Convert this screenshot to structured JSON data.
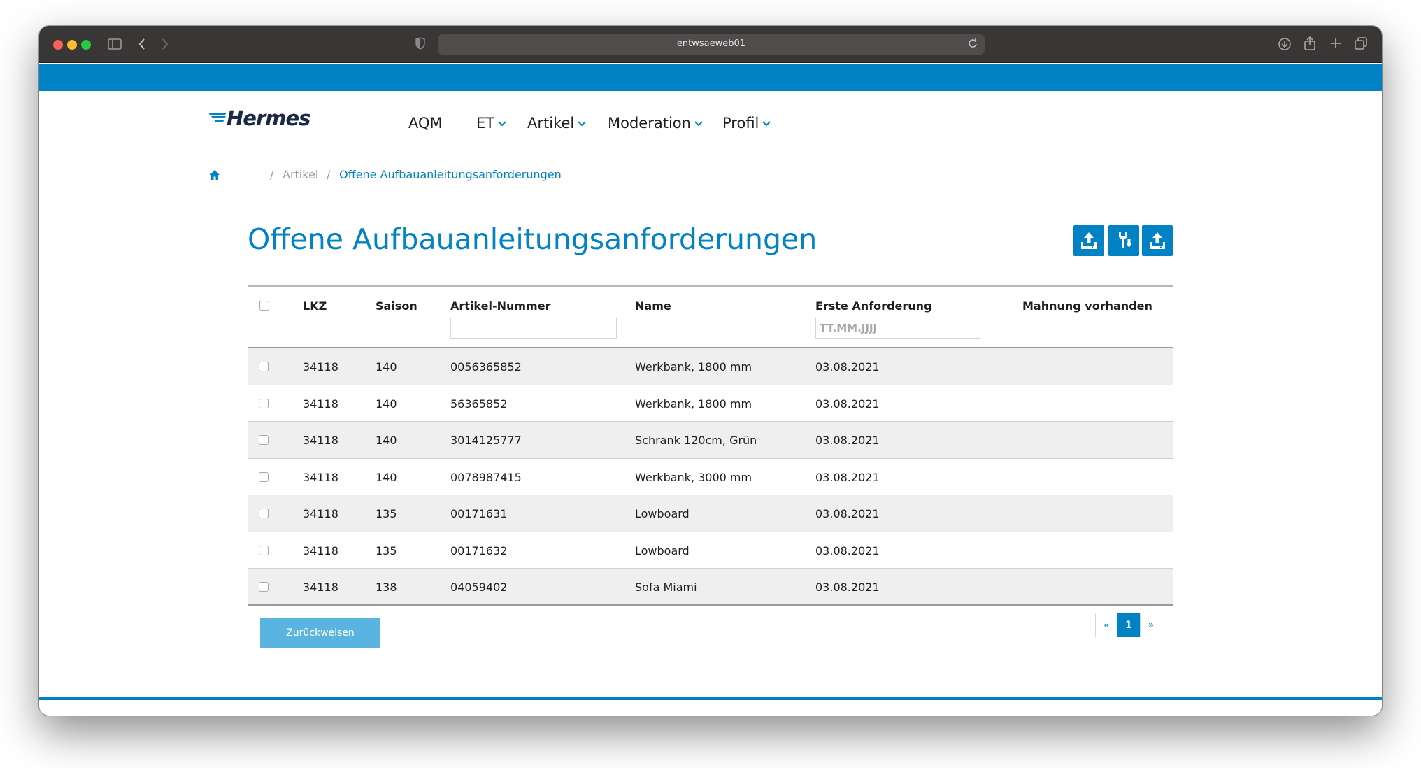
{
  "browser": {
    "url": "entwsaeweb01"
  },
  "brand": {
    "logo_text": "Hermes",
    "accent_color": "#0182c5"
  },
  "nav": {
    "items": [
      {
        "label": "AQM",
        "has_dropdown": false
      },
      {
        "label": "ET",
        "has_dropdown": true
      },
      {
        "label": "Artikel",
        "has_dropdown": true
      },
      {
        "label": "Moderation",
        "has_dropdown": true
      },
      {
        "label": "Profil",
        "has_dropdown": true
      }
    ]
  },
  "breadcrumb": {
    "home_icon": "home-icon",
    "items": [
      "Artikel",
      "Offene Aufbauanleitungsanforderungen"
    ]
  },
  "page": {
    "title": "Offene Aufbauanleitungsanforderungen",
    "actions": [
      {
        "icon": "upload-icon"
      },
      {
        "icon": "download-tool-icon"
      },
      {
        "icon": "upload-icon"
      }
    ]
  },
  "table": {
    "columns": [
      "LKZ",
      "Saison",
      "Artikel-Nummer",
      "Name",
      "Erste Anforderung",
      "Mahnung vorhanden"
    ],
    "filters": {
      "artikel_nummer": {
        "value": "",
        "placeholder": ""
      },
      "erste_anforderung": {
        "value": "",
        "placeholder": "TT.MM.JJJJ"
      }
    },
    "rows": [
      {
        "lkz": "34118",
        "saison": "140",
        "artikel": "0056365852",
        "name": "Werkbank, 1800 mm",
        "datum": "03.08.2021",
        "mahnung": ""
      },
      {
        "lkz": "34118",
        "saison": "140",
        "artikel": "56365852",
        "name": "Werkbank, 1800 mm",
        "datum": "03.08.2021",
        "mahnung": ""
      },
      {
        "lkz": "34118",
        "saison": "140",
        "artikel": "3014125777",
        "name": "Schrank 120cm, Grün",
        "datum": "03.08.2021",
        "mahnung": ""
      },
      {
        "lkz": "34118",
        "saison": "140",
        "artikel": "0078987415",
        "name": "Werkbank, 3000 mm",
        "datum": "03.08.2021",
        "mahnung": ""
      },
      {
        "lkz": "34118",
        "saison": "135",
        "artikel": "00171631",
        "name": "Lowboard",
        "datum": "03.08.2021",
        "mahnung": ""
      },
      {
        "lkz": "34118",
        "saison": "135",
        "artikel": "00171632",
        "name": "Lowboard",
        "datum": "03.08.2021",
        "mahnung": ""
      },
      {
        "lkz": "34118",
        "saison": "138",
        "artikel": "04059402",
        "name": "Sofa Miami",
        "datum": "03.08.2021",
        "mahnung": ""
      }
    ]
  },
  "footer": {
    "reject_label": "Zurückweisen",
    "pagination": {
      "prev": "«",
      "current": "1",
      "next": "»"
    }
  }
}
